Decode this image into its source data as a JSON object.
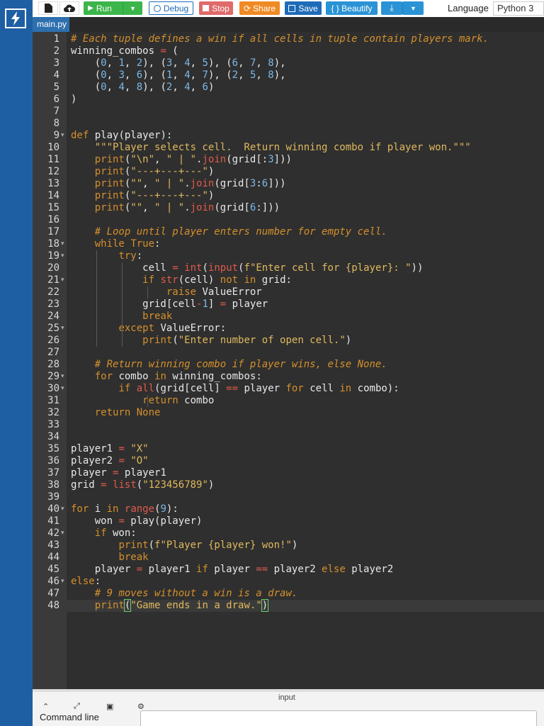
{
  "toolbar": {
    "run_label": "Run",
    "debug_label": "Debug",
    "stop_label": "Stop",
    "share_label": "Share",
    "save_label": "Save",
    "beautify_label": "{ } Beautify",
    "language_label": "Language",
    "language_value": "Python 3"
  },
  "tabs": [
    {
      "label": "main.py"
    }
  ],
  "editor": {
    "line_numbers": [
      "1",
      "2",
      "3",
      "4",
      "5",
      "6",
      "7",
      "8",
      "9",
      "10",
      "11",
      "12",
      "13",
      "14",
      "15",
      "16",
      "17",
      "18",
      "19",
      "20",
      "21",
      "22",
      "23",
      "24",
      "25",
      "26",
      "27",
      "28",
      "29",
      "30",
      "31",
      "32",
      "33",
      "34",
      "35",
      "36",
      "37",
      "38",
      "39",
      "40",
      "41",
      "42",
      "43",
      "44",
      "45",
      "46",
      "47",
      "48"
    ],
    "lines": [
      "# Each tuple defines a win if all cells in tuple contain players mark.",
      "winning_combos = (",
      "    (0, 1, 2), (3, 4, 5), (6, 7, 8),",
      "    (0, 3, 6), (1, 4, 7), (2, 5, 8),",
      "    (0, 4, 8), (2, 4, 6)",
      ")",
      "",
      "",
      "def play(player):",
      "    \"\"\"Player selects cell.  Return winning combo if player won.\"\"\"",
      "    print(\"\\n\", \" | \".join(grid[:3]))",
      "    print(\"---+---+---\")",
      "    print(\"\", \" | \".join(grid[3:6]))",
      "    print(\"---+---+---\")",
      "    print(\"\", \" | \".join(grid[6:]))",
      "",
      "    # Loop until player enters number for empty cell.",
      "    while True:",
      "        try:",
      "            cell = int(input(f\"Enter cell for {player}: \"))",
      "            if str(cell) not in grid:",
      "                raise ValueError",
      "            grid[cell-1] = player",
      "            break",
      "        except ValueError:",
      "            print(\"Enter number of open cell.\")",
      "",
      "    # Return winning combo if player wins, else None.",
      "    for combo in winning_combos:",
      "        if all(grid[cell] == player for cell in combo):",
      "            return combo",
      "    return None",
      "",
      "",
      "player1 = \"X\"",
      "player2 = \"O\"",
      "player = player1",
      "grid = list(\"123456789\")",
      "",
      "for i in range(9):",
      "    won = play(player)",
      "    if won:",
      "        print(f\"Player {player} won!\")",
      "        break",
      "    player = player1 if player == player2 else player2",
      "else:",
      "    # 9 moves without a win is a draw.",
      "    print(\"Game ends in a draw.\")"
    ]
  },
  "bottom": {
    "input_label": "input",
    "command_line_label": "Command line"
  },
  "colors": {
    "accent": "#1e5fa3",
    "run": "#3cb54a",
    "stop": "#e06a6a",
    "share": "#f08a24",
    "save": "#1e6bb8",
    "beautify": "#2a93d5",
    "editor_bg": "#2f2f2f",
    "comment": "#d5902c",
    "string": "#e0b95e",
    "number": "#7ab8e8",
    "builtin": "#e05a4a"
  }
}
